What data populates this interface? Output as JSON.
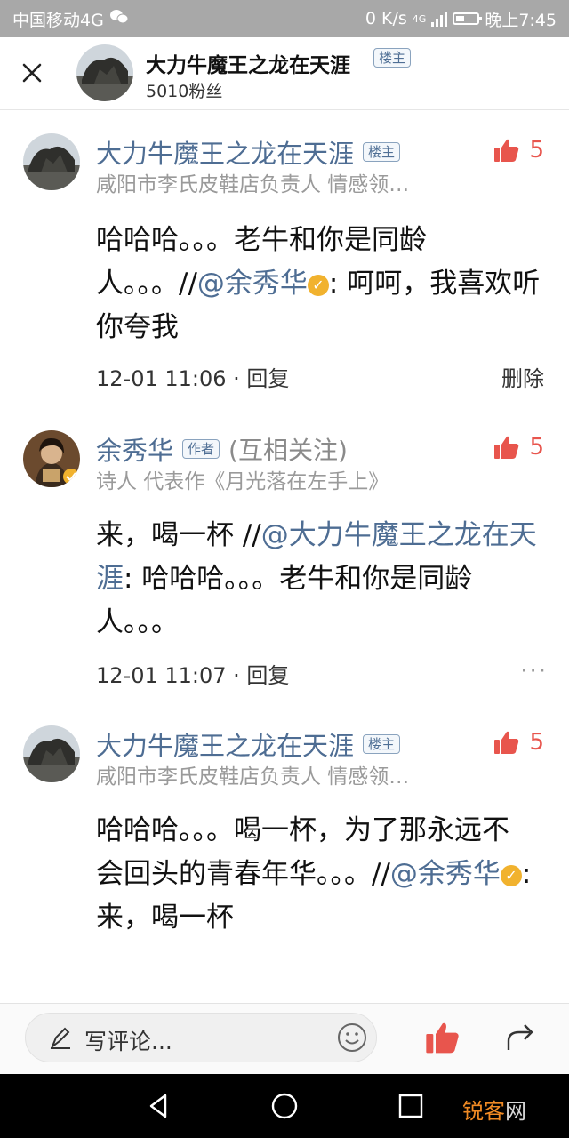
{
  "status_bar": {
    "carrier": "中国移动4G",
    "speed": "0 K/s",
    "network": "4G",
    "time": "晚上7:45"
  },
  "header": {
    "name": "大力牛魔王之龙在天涯",
    "badge": "楼主",
    "fans": "5010粉丝"
  },
  "comments": [
    {
      "name": "大力牛魔王之龙在天涯",
      "badge": "楼主",
      "follow": "",
      "subtitle": "咸阳市李氏皮鞋店负责人 情感领…",
      "likes": "5",
      "text_parts": [
        "哈哈哈。。。老牛和你是同龄人。。。//",
        "@余秀华",
        ": 呵呵，我喜欢听你夸我"
      ],
      "time": "12-01 11:06",
      "reply": "· 回复",
      "action": "删除"
    },
    {
      "name": "余秀华",
      "badge": "作者",
      "follow": "(互相关注)",
      "subtitle": "诗人 代表作《月光落在左手上》",
      "likes": "5",
      "text_parts": [
        "来，喝一杯 //",
        "@大力牛魔王之龙在天涯",
        ": 哈哈哈。。。老牛和你是同龄人。。。"
      ],
      "time": "12-01 11:07",
      "reply": "· 回复",
      "action": "···"
    },
    {
      "name": "大力牛魔王之龙在天涯",
      "badge": "楼主",
      "follow": "",
      "subtitle": "咸阳市李氏皮鞋店负责人 情感领…",
      "likes": "5",
      "text_parts": [
        "哈哈哈。。。喝一杯，为了那永远不会回头的青春年华。。。//",
        "@余秀华",
        ": 来，喝一杯"
      ]
    }
  ],
  "bottom_bar": {
    "placeholder": "写评论..."
  },
  "watermark": {
    "part1": "锐客",
    "part2": "网"
  },
  "colors": {
    "link": "#4e6d93",
    "like": "#e8554d",
    "status_bar": "#a8a8a8"
  }
}
